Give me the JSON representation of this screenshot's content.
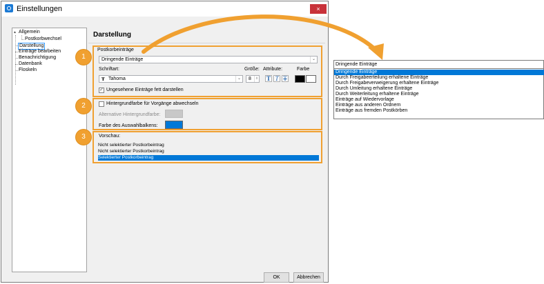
{
  "window": {
    "title": "Einstellungen",
    "close_glyph": "×"
  },
  "tree": {
    "root": "Allgemein",
    "root_toggle": "▴",
    "items": [
      "Postkorbwechsel",
      "Darstellung",
      "Einträge bearbeiten",
      "Benachrichtigung",
      "Datenbank",
      "Floskeln"
    ]
  },
  "panel": {
    "title": "Darstellung",
    "section1": {
      "group_label": "Postkorbeinträge",
      "combo_value": "Dringende Einträge",
      "font_label": "Schriftart:",
      "size_label": "Größe:",
      "attr_label": "Attribute:",
      "color_label": "Farbe",
      "font_value": "Tahoma",
      "size_value": "8",
      "bold_glyph": "T",
      "italic_glyph": "T",
      "strike_glyph": "T",
      "unread_bold_label": "Ungesehene Einträge fett darstellen",
      "unread_checked": true
    },
    "section2": {
      "alternate_bg_label": "Hintergrundfarbe für Vorgänge abwechseln",
      "alt_bg_color_label": "Alternative Hintergrundfarbe:",
      "selection_bar_label": "Farbe des Auswahlbalkens:",
      "alt_bg_color": "#c8c8c8",
      "selection_color": "#0078d7"
    },
    "section3": {
      "preview_label": "Vorschau:",
      "rows": [
        "Nicht selektierter Postkorbeintrag",
        "Nicht selektierter Postkorbeintrag",
        "Selektierter Postkorbeintrag"
      ]
    },
    "badges": [
      "1",
      "2",
      "3"
    ]
  },
  "buttons": {
    "ok": "OK",
    "cancel": "Abbrechen"
  },
  "dropdown": {
    "selected": "Dringende Einträge",
    "options": [
      "Dringende Einträge",
      "Durch Freigabeerteilung erhaltene Einträge",
      "Durch Freigabeverweigerung erhaltene Einträge",
      "Durch Umleitung erhaltene Einträge",
      "Durch Weiterleitung erhaltene Einträge",
      "Einträge auf Wiedervorlage",
      "Einträge aus anderen Ordnern",
      "Einträge aus fremden Postkörben"
    ]
  },
  "colors": {
    "accent": "#f0a030",
    "selection": "#0078d7",
    "close": "#c8323a"
  }
}
